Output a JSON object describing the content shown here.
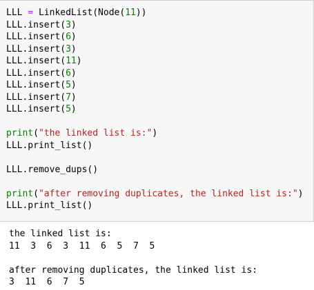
{
  "code_cell": {
    "line1": {
      "a": "LLL",
      "op": "=",
      "b": "LinkedList(Node(",
      "num": "11",
      "c": "))"
    },
    "inserts": [
      {
        "prefix": "LLL.insert(",
        "num": "3",
        "suffix": ")"
      },
      {
        "prefix": "LLL.insert(",
        "num": "6",
        "suffix": ")"
      },
      {
        "prefix": "LLL.insert(",
        "num": "3",
        "suffix": ")"
      },
      {
        "prefix": "LLL.insert(",
        "num": "11",
        "suffix": ")"
      },
      {
        "prefix": "LLL.insert(",
        "num": "6",
        "suffix": ")"
      },
      {
        "prefix": "LLL.insert(",
        "num": "5",
        "suffix": ")"
      },
      {
        "prefix": "LLL.insert(",
        "num": "7",
        "suffix": ")"
      },
      {
        "prefix": "LLL.insert(",
        "num": "5",
        "suffix": ")"
      }
    ],
    "print1": {
      "kw": "print",
      "open": "(",
      "str": "\"the linked list is:\"",
      "close": ")"
    },
    "print_list_1": "LLL.print_list()",
    "remove_dups": "LLL.remove_dups()",
    "print2": {
      "kw": "print",
      "open": "(",
      "str": "\"after removing duplicates, the linked list is:\"",
      "close": ")"
    },
    "print_list_2": "LLL.print_list()"
  },
  "output": {
    "line1": "the linked list is:",
    "line2": "11  3  6  3  11  6  5  7  5",
    "line3": "after removing duplicates, the linked list is:",
    "line4": "3  11  6  7  5"
  },
  "colors": {
    "cell_background": "#f7f7f7",
    "cell_border": "#cfcfcf",
    "number": "#008000",
    "keyword": "#008000",
    "string": "#ba2121",
    "operator": "#aa22ff"
  }
}
